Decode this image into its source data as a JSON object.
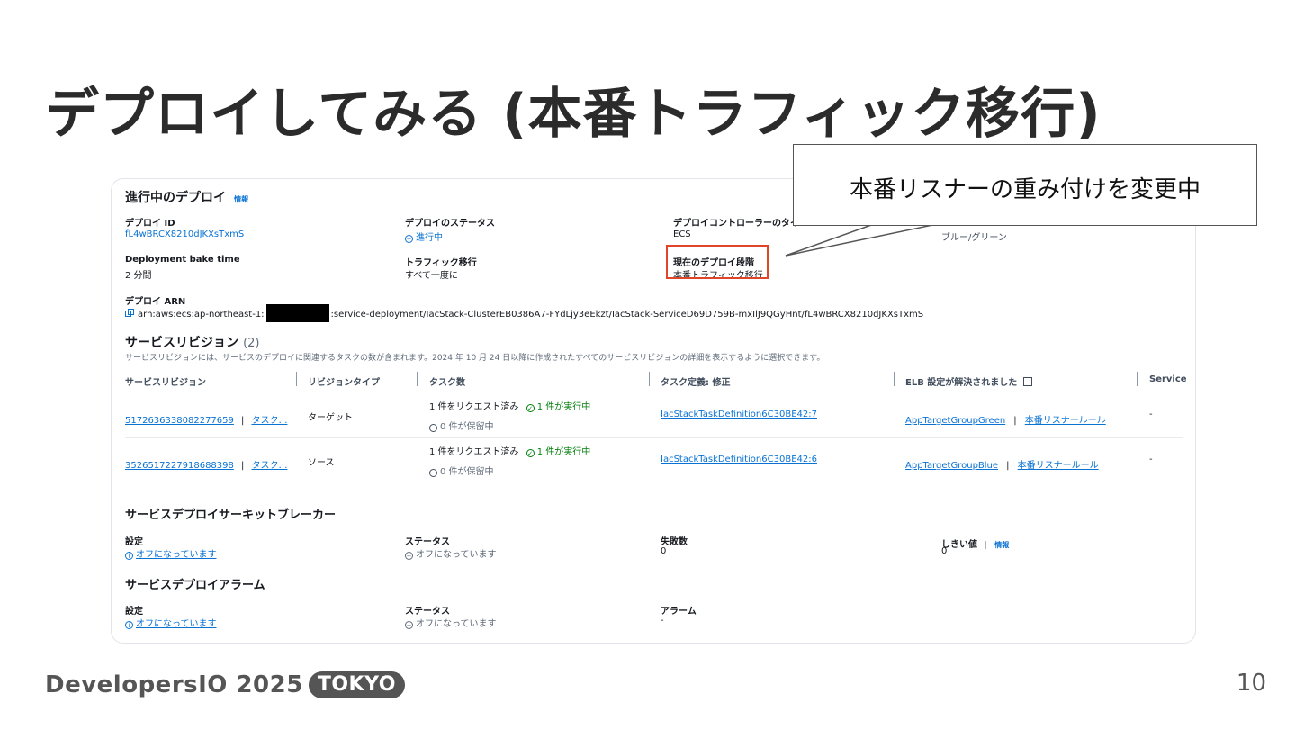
{
  "slide": {
    "title": "デプロイしてみる (本番トラフィック移行)",
    "page_number": "10",
    "brand": "DevelopersIO 2025",
    "brand_badge": "TOKYO"
  },
  "callout": {
    "text": "本番リスナーの重み付けを変更中"
  },
  "deployment": {
    "heading": "進行中のデプロイ",
    "info": "情報",
    "fields": {
      "id_label": "デプロイ ID",
      "id_value": "fL4wBRCX8210dJKXsTxmS",
      "status_label": "デプロイのステータス",
      "status_value": "進行中",
      "controller_label": "デプロイコントローラーのタイ",
      "controller_value": "ECS",
      "strategy_value": "ブルー/グリーン",
      "bake_label": "Deployment bake time",
      "bake_value": "2 分間",
      "traffic_label": "トラフィック移行",
      "traffic_value": "すべて一度に",
      "stage_label": "現在のデプロイ段階",
      "stage_value": "本番トラフィック移行",
      "arn_label": "デプロイ ARN",
      "arn_prefix": "arn:aws:ecs:ap-northeast-1:",
      "arn_suffix": ":service-deployment/IacStack-ClusterEB0386A7-FYdLjy3eEkzt/IacStack-ServiceD69D759B-mxIlJ9QGyHnt/fL4wBRCX8210dJKXsTxmS"
    }
  },
  "revisions": {
    "heading": "サービスリビジョン",
    "count": "(2)",
    "description": "サービスリビジョンには、サービスのデプロイに関連するタスクの数が含まれます。2024 年 10 月 24 日以降に作成されたすべてのサービスリビジョンの詳細を表示するように選択できます。",
    "columns": [
      "サービスリビジョン",
      "リビジョンタイプ",
      "タスク数",
      "タスク定義: 修正",
      "ELB 設定が解決されました",
      "Service"
    ],
    "rows": [
      {
        "revision": "5172636338082277659",
        "task_link": "タスク…",
        "type": "ターゲット",
        "requested": "1 件をリクエスト済み",
        "running": "1 件が実行中",
        "pending": "0 件が保留中",
        "task_def": "IacStackTaskDefinition6C30BE42:7",
        "target_group": "AppTargetGroupGreen",
        "listener_rule": "本番リスナールール",
        "service": "-"
      },
      {
        "revision": "3526517227918688398",
        "task_link": "タスク…",
        "type": "ソース",
        "requested": "1 件をリクエスト済み",
        "running": "1 件が実行中",
        "pending": "0 件が保留中",
        "task_def": "IacStackTaskDefinition6C30BE42:6",
        "target_group": "AppTargetGroupBlue",
        "listener_rule": "本番リスナールール",
        "service": "-"
      }
    ]
  },
  "breaker": {
    "heading": "サービスデプロイサーキットブレーカー",
    "setting_label": "設定",
    "setting_value": "オフになっています",
    "status_label": "ステータス",
    "status_value": "オフになっています",
    "failures_label": "失敗数",
    "failures_value": "0",
    "threshold_label": "しきい値",
    "threshold_info": "情報",
    "threshold_value": "0"
  },
  "alarms": {
    "heading": "サービスデプロイアラーム",
    "setting_label": "設定",
    "setting_value": "オフになっています",
    "status_label": "ステータス",
    "status_value": "オフになっています",
    "alarm_label": "アラーム",
    "alarm_value": "-"
  }
}
